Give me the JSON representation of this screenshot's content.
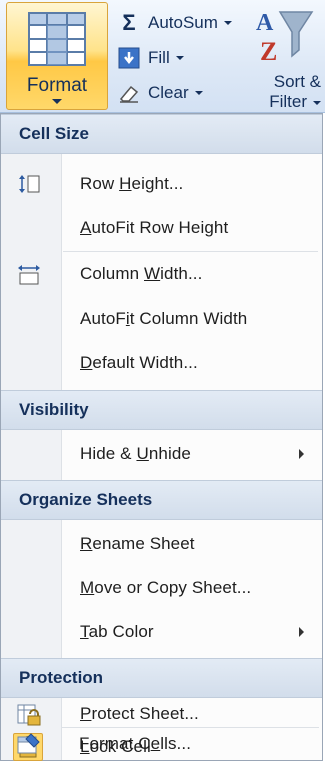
{
  "ribbon": {
    "format_label": "Format",
    "autosum_label": "AutoSum",
    "fill_label": "Fill",
    "clear_label": "Clear",
    "sort_line1": "Sort &",
    "sort_line2": "Filter",
    "sigma_glyph": "Σ"
  },
  "menu": {
    "sections": [
      {
        "header": "Cell Size",
        "items": [
          {
            "before": "Row ",
            "key": "H",
            "after": "eight...",
            "icon": "row-height-icon"
          },
          {
            "before": "",
            "key": "A",
            "after": "utoFit Row Height",
            "icon": ""
          },
          {
            "before": "Column ",
            "key": "W",
            "after": "idth...",
            "icon": "column-width-icon"
          },
          {
            "before": "AutoF",
            "key": "i",
            "after": "t Column Width",
            "icon": ""
          },
          {
            "before": "",
            "key": "D",
            "after": "efault Width...",
            "icon": ""
          }
        ]
      },
      {
        "header": "Visibility",
        "items": [
          {
            "before": "Hide & ",
            "key": "U",
            "after": "nhide",
            "icon": "",
            "submenu": true
          }
        ]
      },
      {
        "header": "Organize Sheets",
        "items": [
          {
            "before": "",
            "key": "R",
            "after": "ename Sheet",
            "icon": ""
          },
          {
            "before": "",
            "key": "M",
            "after": "ove or Copy Sheet...",
            "icon": ""
          },
          {
            "before": "",
            "key": "T",
            "after": "ab Color",
            "icon": "",
            "submenu": true
          }
        ]
      },
      {
        "header": "Protection",
        "items": [
          {
            "before": "",
            "key": "P",
            "after": "rotect Sheet...",
            "icon": "protect-sheet-icon"
          },
          {
            "before": "",
            "key": "L",
            "after": "ock Cell",
            "icon": "lock-cell-icon"
          },
          {
            "before": "Format C",
            "key": "e",
            "after": "lls...",
            "icon": "format-cells-icon"
          }
        ]
      }
    ]
  },
  "colors": {
    "header_text": "#15305b",
    "highlight": "#ffd86a",
    "menu_text": "#1e1e1e"
  }
}
